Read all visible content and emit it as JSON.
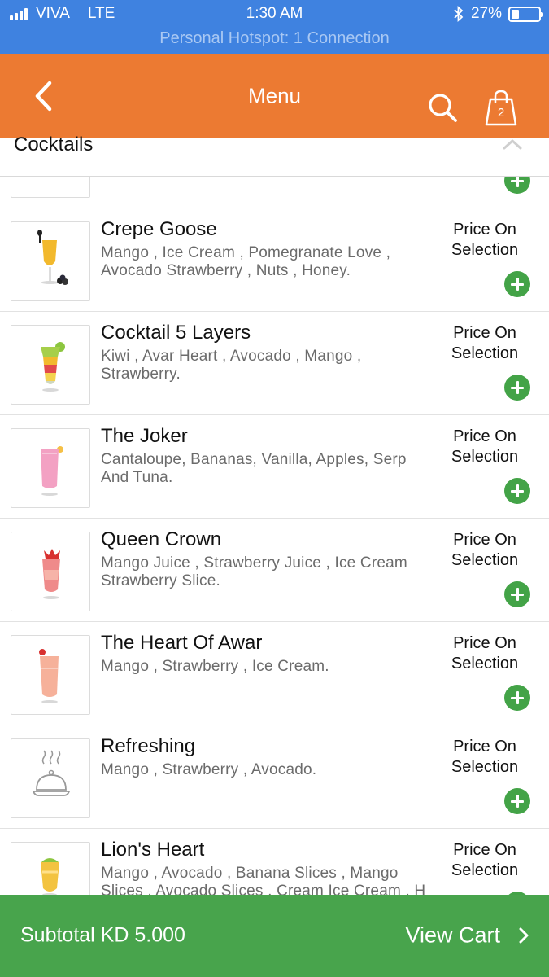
{
  "status_bar": {
    "carrier": "VIVA",
    "network": "LTE",
    "time": "1:30 AM",
    "battery": "27%",
    "battery_level": 0.27,
    "hotspot": "Personal Hotspot: 1 Connection",
    "icons": [
      "signal-icon",
      "bluetooth-icon",
      "battery-icon"
    ]
  },
  "nav": {
    "title": "Menu",
    "cart_count": "2",
    "icons": [
      "back-icon",
      "search-icon",
      "shopping-bag-icon"
    ]
  },
  "category": {
    "title": "Cocktails",
    "icon": "chevron-up-icon"
  },
  "items": [
    {
      "name": "",
      "desc": "",
      "price": "",
      "image": "cocktail-glass"
    },
    {
      "name": "Crepe Goose",
      "desc": "Mango , Ice Cream , Pomegranate Love , Avocado Strawberry , Nuts , Honey.",
      "price": "Price On Selection",
      "image": "cocktail-glass"
    },
    {
      "name": "Cocktail 5 Layers",
      "desc": "Kiwi , Avar Heart , Avocado , Mango , Strawberry.",
      "price": "Price On Selection",
      "image": "cocktail-glass"
    },
    {
      "name": "The Joker",
      "desc": "Cantaloupe, Bananas, Vanilla, Apples, Serp And Tuna.",
      "price": "Price On Selection",
      "image": "cocktail-glass"
    },
    {
      "name": "Queen Crown",
      "desc": "Mango Juice , Strawberry Juice , Ice Cream Strawberry Slice.",
      "price": "Price On Selection",
      "image": "cocktail-glass"
    },
    {
      "name": "The Heart Of Awar",
      "desc": "Mango , Strawberry , Ice Cream.",
      "price": "Price On Selection",
      "image": "cocktail-glass"
    },
    {
      "name": "Refreshing",
      "desc": "Mango , Strawberry , Avocado.",
      "price": "Price On Selection",
      "image": "food-cloche-icon"
    },
    {
      "name": "Lion's Heart",
      "desc": "Mango , Avocado , Banana Slices , Mango Slices , Avocado Slices , Cream Ice Cream , H",
      "price": "Price On Selection",
      "image": "cocktail-glass"
    }
  ],
  "footer": {
    "subtotal": "Subtotal KD 5.000",
    "view_cart": "View Cart",
    "icon": "chevron-right-icon"
  },
  "colors": {
    "status_bar": "#3f82e0",
    "nav_bar": "#ec7a32",
    "add_button": "#43a347",
    "footer": "#48a44c"
  }
}
